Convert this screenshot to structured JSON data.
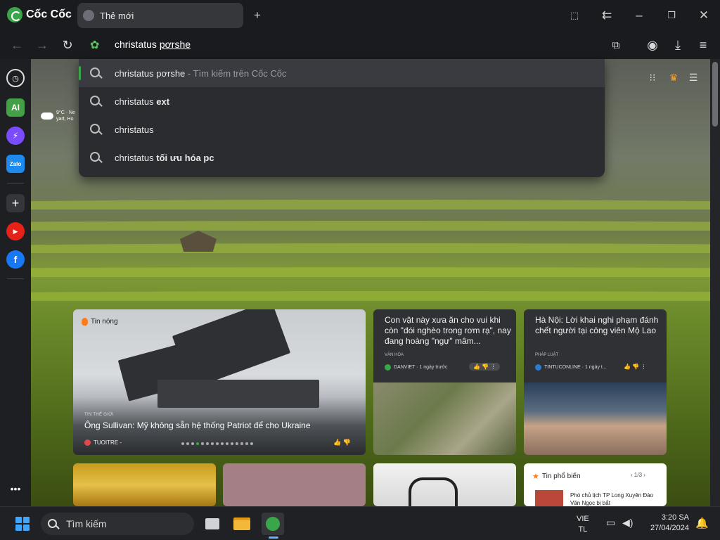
{
  "browser": {
    "brand": "Cốc Cốc",
    "tab_title": "Thẻ mới",
    "address_query": "christatus",
    "address_query_highlight": "pơrshe"
  },
  "suggestions": [
    {
      "text": "christatus pơrshe",
      "hint": "- Tìm kiếm trên Cốc Cốc",
      "bold": ""
    },
    {
      "text": "christatus ",
      "hint": "",
      "bold": "ext"
    },
    {
      "text": "christatus",
      "hint": "",
      "bold": ""
    },
    {
      "text": "christatus ",
      "hint": "",
      "bold": "tối ưu hóa pc"
    }
  ],
  "sidebar": {
    "items": [
      "history",
      "AI",
      "messenger",
      "Zalo",
      "add",
      "youtube",
      "facebook",
      "more"
    ],
    "ai_label": "AI",
    "zalo_label": "Zalo"
  },
  "weather": {
    "line1": "9°C · Ne",
    "line2": "yart, Ho"
  },
  "news": {
    "hero": {
      "badge": "Tin nóng",
      "category": "TIN THẾ GIỚI",
      "title": "Ông Sullivan: Mỹ không sẵn hệ thống Patriot để cho Ukraine",
      "source": "TUOITRE -"
    },
    "card2": {
      "title": "Con vật này xưa ăn cho vui khi còn \"đói nghèo trong rơm rạ\", nay đang hoàng \"ngự\" mâm...",
      "category": "VĂN HÓA",
      "source": "DANVIET · 1 ngày trước"
    },
    "card3": {
      "title": "Hà Nội: Lời khai nghi phạm đánh chết người tại công viên Mộ Lao",
      "category": "PHÁP LUẬT",
      "source": "TINTUCONLINE · 1 ngày t..."
    },
    "popular": {
      "title": "Tin phổ biến",
      "page": "1/3",
      "item": "Phó chủ tịch TP Long Xuyên Đào Văn Ngọc bị bắt"
    }
  },
  "taskbar": {
    "search_placeholder": "Tìm kiếm",
    "lang1": "VIE",
    "lang2": "TL",
    "time": "3:20 SA",
    "date": "27/04/2024"
  },
  "colors": {
    "accent": "#3aa64a",
    "hot": "#ff7a1a"
  }
}
